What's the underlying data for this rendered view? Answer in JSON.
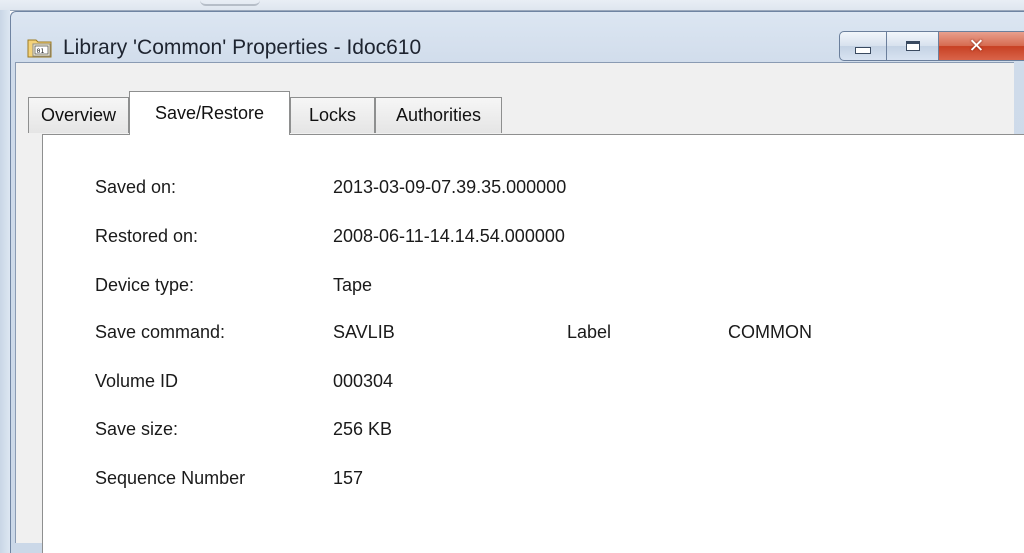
{
  "window": {
    "title": "Library 'Common' Properties - Idoc610",
    "title_icon": "library-folder-icon",
    "controls": {
      "minimize": "minimize-icon",
      "maximize": "maximize-icon",
      "close": "close-icon",
      "close_glyph": "✕"
    },
    "colors": {
      "close_button": "#c74023",
      "titlebar": "#dce6f2",
      "panel_bg": "#ffffff",
      "client_bg": "#f0f0f0"
    }
  },
  "tabs": [
    {
      "label": "Overview",
      "active": false
    },
    {
      "label": "Save/Restore",
      "active": true
    },
    {
      "label": "Locks",
      "active": false
    },
    {
      "label": "Authorities",
      "active": false
    }
  ],
  "fields": {
    "saved_on": {
      "label": "Saved on:",
      "value": "2013-03-09-07.39.35.000000"
    },
    "restored_on": {
      "label": "Restored on:",
      "value": "2008-06-11-14.14.54.000000"
    },
    "device_type": {
      "label": "Device type:",
      "value": "Tape"
    },
    "save_command": {
      "label": "Save command:",
      "value": "SAVLIB"
    },
    "label": {
      "label": "Label",
      "value": "COMMON"
    },
    "volume_id": {
      "label": "Volume ID",
      "value": "000304"
    },
    "save_size": {
      "label": "Save size:",
      "value": "256 KB"
    },
    "sequence_number": {
      "label": "Sequence Number",
      "value": "157"
    }
  }
}
